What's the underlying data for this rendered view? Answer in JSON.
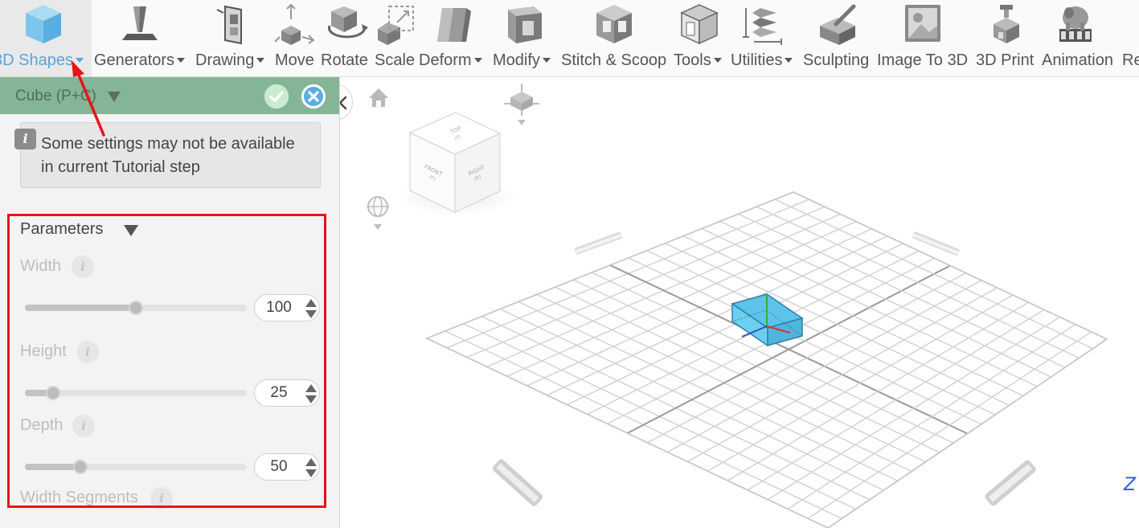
{
  "toolbar": {
    "items": [
      {
        "label": "3D Shapes",
        "icon": "cube-icon",
        "dropdown": true,
        "active": true
      },
      {
        "label": "Generators",
        "icon": "generators-icon",
        "dropdown": true
      },
      {
        "label": "Drawing",
        "icon": "drawing-icon",
        "dropdown": true
      },
      {
        "label": "Move",
        "icon": "move-icon",
        "dropdown": false
      },
      {
        "label": "Rotate",
        "icon": "rotate-icon",
        "dropdown": false
      },
      {
        "label": "Scale",
        "icon": "scale-icon",
        "dropdown": false
      },
      {
        "label": "Deform",
        "icon": "deform-icon",
        "dropdown": true
      },
      {
        "label": "Modify",
        "icon": "modify-icon",
        "dropdown": true
      },
      {
        "label": "Stitch & Scoop",
        "icon": "stitch-scoop-icon",
        "dropdown": false
      },
      {
        "label": "Tools",
        "icon": "tools-icon",
        "dropdown": true
      },
      {
        "label": "Utilities",
        "icon": "utilities-icon",
        "dropdown": true
      },
      {
        "label": "Sculpting",
        "icon": "sculpting-icon",
        "dropdown": false
      },
      {
        "label": "Image To 3D",
        "icon": "image-to-3d-icon",
        "dropdown": false
      },
      {
        "label": "3D Print",
        "icon": "3d-print-icon",
        "dropdown": false
      },
      {
        "label": "Animation",
        "icon": "animation-icon",
        "dropdown": false
      },
      {
        "label": "Re",
        "icon": "",
        "dropdown": false
      }
    ]
  },
  "panel": {
    "title": "Cube (P+C)",
    "notice": "Some settings may not be available in current Tutorial step",
    "parameters_title": "Parameters",
    "params": [
      {
        "label": "Width",
        "value": "100",
        "fraction": 0.5
      },
      {
        "label": "Height",
        "value": "25",
        "fraction": 0.125
      },
      {
        "label": "Depth",
        "value": "50",
        "fraction": 0.25
      },
      {
        "label": "Width Segments",
        "value": "",
        "fraction": 0
      }
    ]
  },
  "viewport": {
    "view_cube": {
      "top": "TOP",
      "top_key": "(T)",
      "front": "FRONT",
      "front_key": "(F)",
      "right": "RIGHT",
      "right_key": "(R)"
    },
    "axis_label": "Z"
  },
  "colors": {
    "accent": "#5ba4d8",
    "panel_header": "#84b597",
    "annotation_red": "#e8131a",
    "shape_blue": "#5cc3ea"
  }
}
